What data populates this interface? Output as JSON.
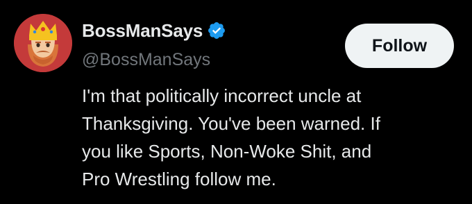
{
  "profile": {
    "display_name": "BossManSays",
    "handle": "@BossManSays",
    "verified": true,
    "avatar_icon": "crowned-bearded-man-avatar",
    "bio_lines": [
      "I'm that politically incorrect uncle at",
      "Thanksgiving. You've been warned. If",
      "you like Sports, Non-Woke Shit, and",
      "Pro Wrestling follow me."
    ]
  },
  "actions": {
    "follow_label": "Follow"
  },
  "colors": {
    "background": "#000000",
    "primary_text": "#e7e9ea",
    "secondary_text": "#71767b",
    "verified_blue": "#1d9bf0",
    "button_bg": "#eff3f4",
    "button_text": "#0f1419",
    "avatar_bg": "#c43a3a"
  }
}
